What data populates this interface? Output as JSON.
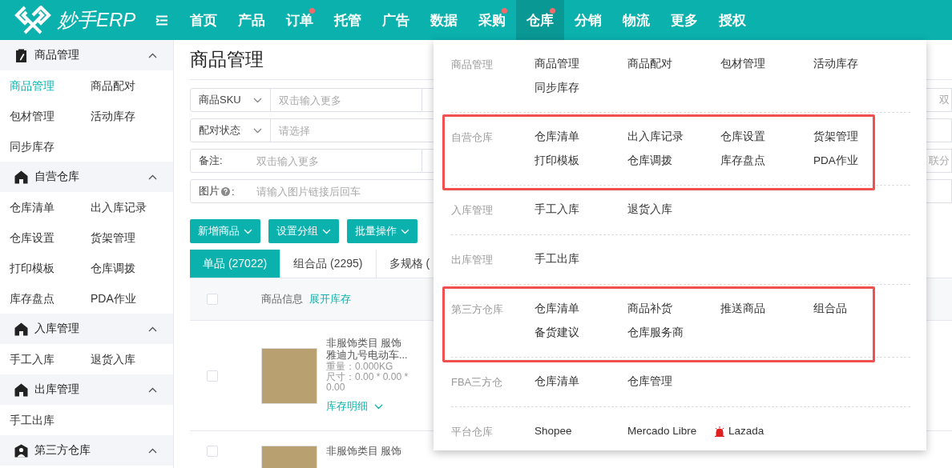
{
  "logo": {
    "text": "妙手ERP"
  },
  "nav": [
    {
      "label": "首页",
      "selected": false,
      "dot": false
    },
    {
      "label": "产品",
      "selected": false,
      "dot": false
    },
    {
      "label": "订单",
      "selected": false,
      "dot": true
    },
    {
      "label": "托管",
      "selected": false,
      "dot": false
    },
    {
      "label": "广告",
      "selected": false,
      "dot": false
    },
    {
      "label": "数据",
      "selected": false,
      "dot": false
    },
    {
      "label": "采购",
      "selected": false,
      "dot": true
    },
    {
      "label": "仓库",
      "selected": true,
      "dot": true
    },
    {
      "label": "分销",
      "selected": false,
      "dot": false
    },
    {
      "label": "物流",
      "selected": false,
      "dot": false
    },
    {
      "label": "更多",
      "selected": false,
      "dot": false
    },
    {
      "label": "授权",
      "selected": false,
      "dot": false
    }
  ],
  "sidebar": {
    "groups": [
      {
        "title": "商品管理",
        "expanded": true,
        "items": [
          {
            "label": "商品管理",
            "selected": true
          },
          {
            "label": "商品配对",
            "selected": false
          },
          {
            "label": "包材管理",
            "selected": false
          },
          {
            "label": "活动库存",
            "selected": false
          },
          {
            "label": "同步库存",
            "selected": false
          }
        ]
      },
      {
        "title": "自营仓库",
        "expanded": true,
        "items": [
          {
            "label": "仓库清单",
            "selected": false
          },
          {
            "label": "出入库记录",
            "selected": false
          },
          {
            "label": "仓库设置",
            "selected": false
          },
          {
            "label": "货架管理",
            "selected": false
          },
          {
            "label": "打印模板",
            "selected": false
          },
          {
            "label": "仓库调拨",
            "selected": false
          },
          {
            "label": "库存盘点",
            "selected": false
          },
          {
            "label": "PDA作业",
            "selected": false
          }
        ]
      },
      {
        "title": "入库管理",
        "expanded": true,
        "items": [
          {
            "label": "手工入库",
            "selected": false
          },
          {
            "label": "退货入库",
            "selected": false
          }
        ]
      },
      {
        "title": "出库管理",
        "expanded": true,
        "items": [
          {
            "label": "手工出库",
            "selected": false
          }
        ]
      },
      {
        "title": "第三方仓库",
        "expanded": true
      }
    ]
  },
  "page": {
    "title": "商品管理"
  },
  "filters": [
    {
      "kind": "select",
      "label": "商品SKU",
      "placeholder": "双击输入更多",
      "trailing": "双"
    },
    {
      "kind": "select",
      "label": "配对状态",
      "placeholder": "请选择"
    },
    {
      "kind": "text",
      "label": "备注:",
      "placeholder": "双击输入更多",
      "trailing": "联分"
    },
    {
      "kind": "help",
      "label": "图片",
      "suffix": ":",
      "placeholder": "请输入图片链接后回车"
    }
  ],
  "actions": [
    "新增商品",
    "设置分组",
    "批量操作"
  ],
  "tabs": [
    {
      "label": "单品 (27022)",
      "selected": true
    },
    {
      "label": "组合品 (2295)",
      "selected": false
    },
    {
      "label": "多规格 (",
      "selected": false
    }
  ],
  "table": {
    "header": {
      "checked": false,
      "title": "商品信息",
      "link": "展开库存"
    },
    "rows": [
      {
        "checked": false,
        "lines": [
          "非服饰类目  服饰",
          "雅迪九号电动车..."
        ],
        "details": [
          "重量：0.000KG",
          "尺寸：0.00 * 0.00 * 0.00"
        ],
        "link": "库存明细"
      },
      {
        "checked": false,
        "lines": [
          "非服饰类目  服饰"
        ],
        "details": []
      }
    ]
  },
  "dropdown": {
    "sections": [
      {
        "label": "商品管理",
        "highlighted": false,
        "items": [
          {
            "label": "商品管理"
          },
          {
            "label": "商品配对"
          },
          {
            "label": "包材管理"
          },
          {
            "label": "活动库存"
          },
          {
            "label": "同步库存"
          }
        ]
      },
      {
        "label": "自营仓库",
        "highlighted": true,
        "items": [
          {
            "label": "仓库清单"
          },
          {
            "label": "出入库记录"
          },
          {
            "label": "仓库设置"
          },
          {
            "label": "货架管理"
          },
          {
            "label": "打印模板"
          },
          {
            "label": "仓库调拨"
          },
          {
            "label": "库存盘点"
          },
          {
            "label": "PDA作业"
          }
        ]
      },
      {
        "label": "入库管理",
        "highlighted": false,
        "items": [
          {
            "label": "手工入库"
          },
          {
            "label": "退货入库"
          }
        ]
      },
      {
        "label": "出库管理",
        "highlighted": false,
        "items": [
          {
            "label": "手工出库"
          }
        ]
      },
      {
        "label": "第三方仓库",
        "highlighted": true,
        "items": [
          {
            "label": "仓库清单"
          },
          {
            "label": "商品补货"
          },
          {
            "label": "推送商品"
          },
          {
            "label": "组合品"
          },
          {
            "label": "备货建议"
          },
          {
            "label": "仓库服务商"
          }
        ]
      },
      {
        "label": "FBA三方仓",
        "highlighted": false,
        "items": [
          {
            "label": "仓库清单"
          },
          {
            "label": "仓库管理"
          }
        ]
      },
      {
        "label": "平台仓库",
        "highlighted": false,
        "items": [
          {
            "label": "Shopee"
          },
          {
            "label": "Mercado Libre"
          },
          {
            "label": "Lazada",
            "alert": true
          }
        ]
      }
    ]
  }
}
